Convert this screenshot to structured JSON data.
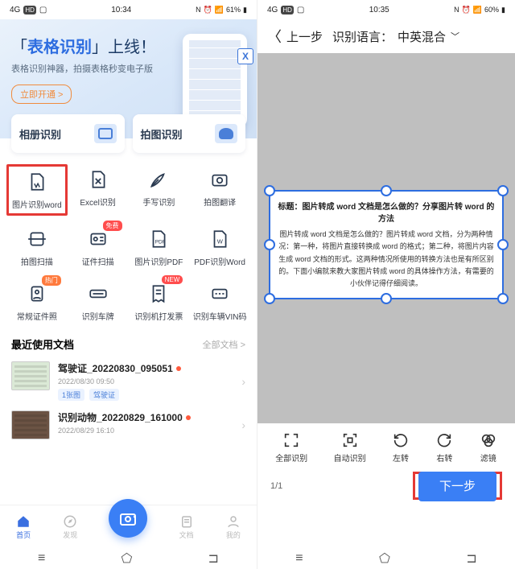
{
  "left": {
    "status": {
      "time": "10:34",
      "battery": "61%",
      "net": "4G"
    },
    "hero": {
      "title_pre": "「",
      "title_hl": "表格识别",
      "title_post": "」上线！",
      "sub": "表格识别神器，拍摄表格秒变电子版",
      "cta": "立即开通 >",
      "x_label": "X"
    },
    "wide_cards": [
      {
        "label": "相册识别"
      },
      {
        "label": "拍图识别"
      }
    ],
    "features_row1": [
      {
        "label": "图片识别word",
        "highlight": true
      },
      {
        "label": "Excel识别"
      },
      {
        "label": "手写识别"
      },
      {
        "label": "拍图翻译"
      }
    ],
    "features_row2": [
      {
        "label": "拍图扫描"
      },
      {
        "label": "证件扫描",
        "badge": "免费"
      },
      {
        "label": "图片识别PDF"
      },
      {
        "label": "PDF识别Word"
      }
    ],
    "features_row3": [
      {
        "label": "常规证件照",
        "badge": "热门"
      },
      {
        "label": "识别车牌"
      },
      {
        "label": "识别机打发票",
        "badge": "NEW"
      },
      {
        "label": "识别车辆VIN码"
      }
    ],
    "recent": {
      "header": "最近使用文档",
      "more": "全部文档 >",
      "docs": [
        {
          "title": "驾驶证_20220830_095051",
          "meta": "2022/08/30  09:50",
          "tags": [
            "1张图",
            "驾驶证"
          ]
        },
        {
          "title": "识别动物_20220829_161000",
          "meta": "2022/08/29  16:10",
          "tags": []
        }
      ]
    },
    "nav": {
      "home": "首页",
      "discover": "发现",
      "docs": "文档",
      "me": "我的"
    }
  },
  "right": {
    "status": {
      "time": "10:35",
      "battery": "60%",
      "net": "4G"
    },
    "header": {
      "back": "上一步",
      "lang_label": "识别语言：",
      "lang_value": "中英混合"
    },
    "crop": {
      "title": "标题：图片转成 word 文档是怎么做的？分享图片转 word 的方法",
      "body": "图片转成 word 文档是怎么做的？图片转成 word 文档，分为两种情况：第一种，将图片直接转换成 word 的格式；第二种，将图片内容生成 word 文档的形式。这两种情况所使用的转换方法也是有所区别的。下面小编就来教大家图片转成 word 的具体操作方法，有需要的小伙伴记得仔细阅读。"
    },
    "tools": [
      {
        "label": "全部识别"
      },
      {
        "label": "自动识别"
      },
      {
        "label": "左转"
      },
      {
        "label": "右转"
      },
      {
        "label": "滤镜"
      }
    ],
    "page": "1/1",
    "next": "下一步"
  }
}
